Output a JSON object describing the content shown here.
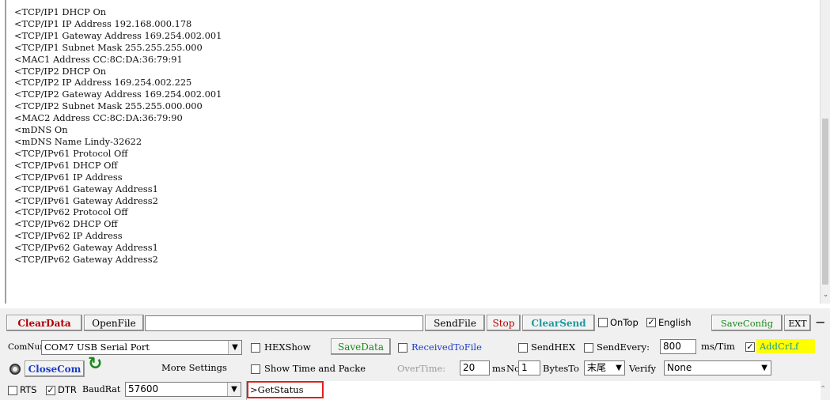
{
  "log_lines": [
    "<TCP/IP1 DHCP On",
    "<TCP/IP1 IP Address 192.168.000.178",
    "<TCP/IP1 Gateway Address 169.254.002.001",
    "<TCP/IP1 Subnet Mask 255.255.255.000",
    "<MAC1 Address CC:8C:DA:36:79:91",
    "<TCP/IP2 DHCP On",
    "<TCP/IP2 IP Address 169.254.002.225",
    "<TCP/IP2 Gateway Address 169.254.002.001",
    "<TCP/IP2 Subnet Mask 255.255.000.000",
    "<MAC2 Address CC:8C:DA:36:79:90",
    "<mDNS On",
    "<mDNS Name Lindy-32622",
    "<TCP/IPv61 Protocol Off",
    "<TCP/IPv61 DHCP Off",
    "<TCP/IPv61 IP Address",
    "<TCP/IPv61 Gateway Address1",
    "<TCP/IPv61 Gateway Address2",
    "<TCP/IPv62 Protocol Off",
    "<TCP/IPv62 DHCP Off",
    "<TCP/IPv62 IP Address",
    "<TCP/IPv62 Gateway Address1",
    "<TCP/IPv62 Gateway Address2"
  ],
  "row1": {
    "clear_data": "ClearData",
    "open_file": "OpenFile",
    "send_file": "SendFile",
    "stop": "Stop",
    "clear_send": "ClearSend",
    "on_top": "OnTop",
    "english": "English",
    "save_config": "SaveConfig",
    "ext": "EXT",
    "dash": "—"
  },
  "row2": {
    "comnum_label": "ComNum",
    "com_port": "COM7 USB Serial Port",
    "hex_show": "HEXShow",
    "save_data": "SaveData",
    "received_to_file": "ReceivedToFile",
    "send_hex": "SendHEX",
    "send_every": "SendEvery:",
    "send_every_value": "800",
    "ms_tim": "ms/Tim",
    "add_crlf": "AddCrLf"
  },
  "row3": {
    "close_com": "CloseCom",
    "more_settings": "More Settings",
    "show_time": "Show Time and Packe",
    "over_time": "OverTime:",
    "over_time_value": "20",
    "ms": "ms",
    "no": "No",
    "no_value": "1",
    "bytes_to": "BytesTo",
    "bytes_to_value": "末尾",
    "verify": "Verify",
    "verify_value": "None"
  },
  "row4": {
    "rts": "RTS",
    "dtr": "DTR",
    "baud_label": "BaudRat",
    "baud_value": "57600",
    "send_text": ">GetStatus"
  },
  "colors": {
    "highlight_red": "#e0201a",
    "yellow": "#ffff00",
    "blue_text": "#1a3cc8",
    "red_text": "#b00000"
  }
}
